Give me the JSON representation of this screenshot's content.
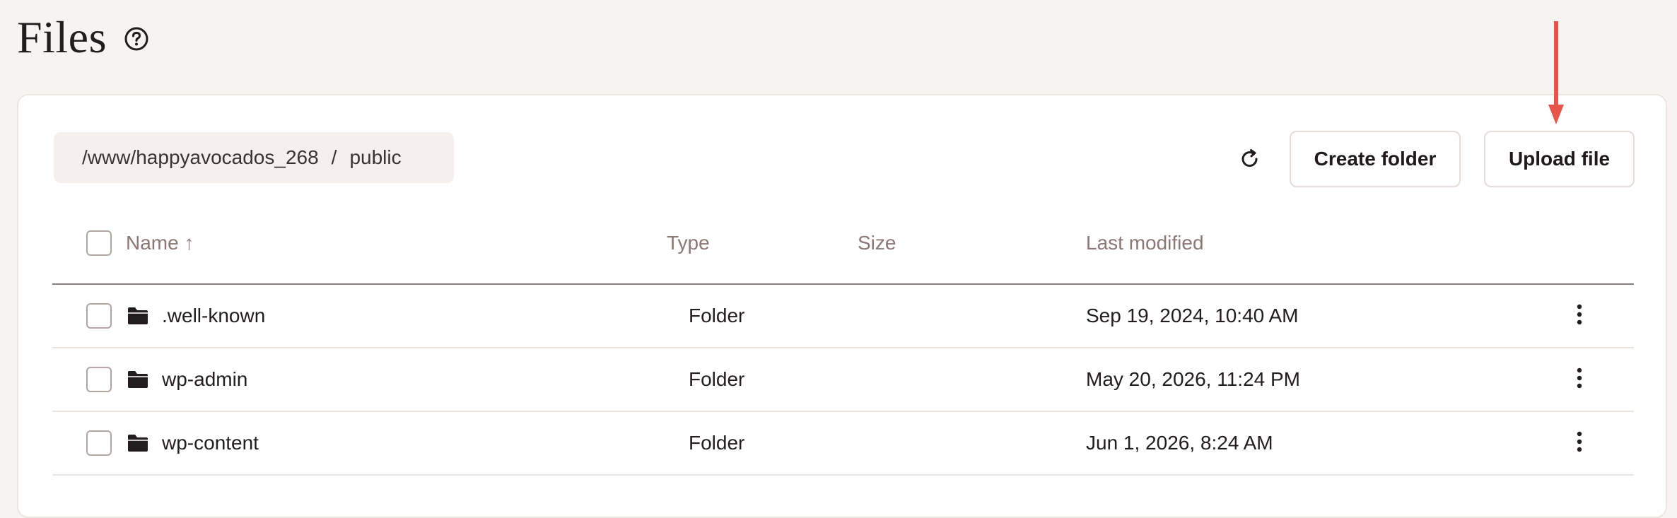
{
  "page": {
    "title": "Files",
    "help_icon": "question-circle-icon"
  },
  "breadcrumb": {
    "path": "/www/happyavocados_268",
    "separator": "/",
    "current": "public"
  },
  "toolbar": {
    "refresh_icon": "refresh-icon",
    "create_folder_label": "Create folder",
    "upload_file_label": "Upload file"
  },
  "table": {
    "columns": {
      "name": "Name ↑",
      "type": "Type",
      "size": "Size",
      "last_modified": "Last modified"
    },
    "rows": [
      {
        "icon": "folder-icon",
        "name": ".well-known",
        "type": "Folder",
        "size": "",
        "last_modified": "Sep 19, 2024, 10:40 AM"
      },
      {
        "icon": "folder-icon",
        "name": "wp-admin",
        "type": "Folder",
        "size": "",
        "last_modified": "May 20, 2026, 11:24 PM"
      },
      {
        "icon": "folder-icon",
        "name": "wp-content",
        "type": "Folder",
        "size": "",
        "last_modified": "Jun 1, 2026, 8:24 AM"
      }
    ]
  },
  "colors": {
    "background": "#f7f3f0",
    "card": "#ffffff",
    "header_text": "#8b7874",
    "annotation_arrow": "#e8534a"
  }
}
